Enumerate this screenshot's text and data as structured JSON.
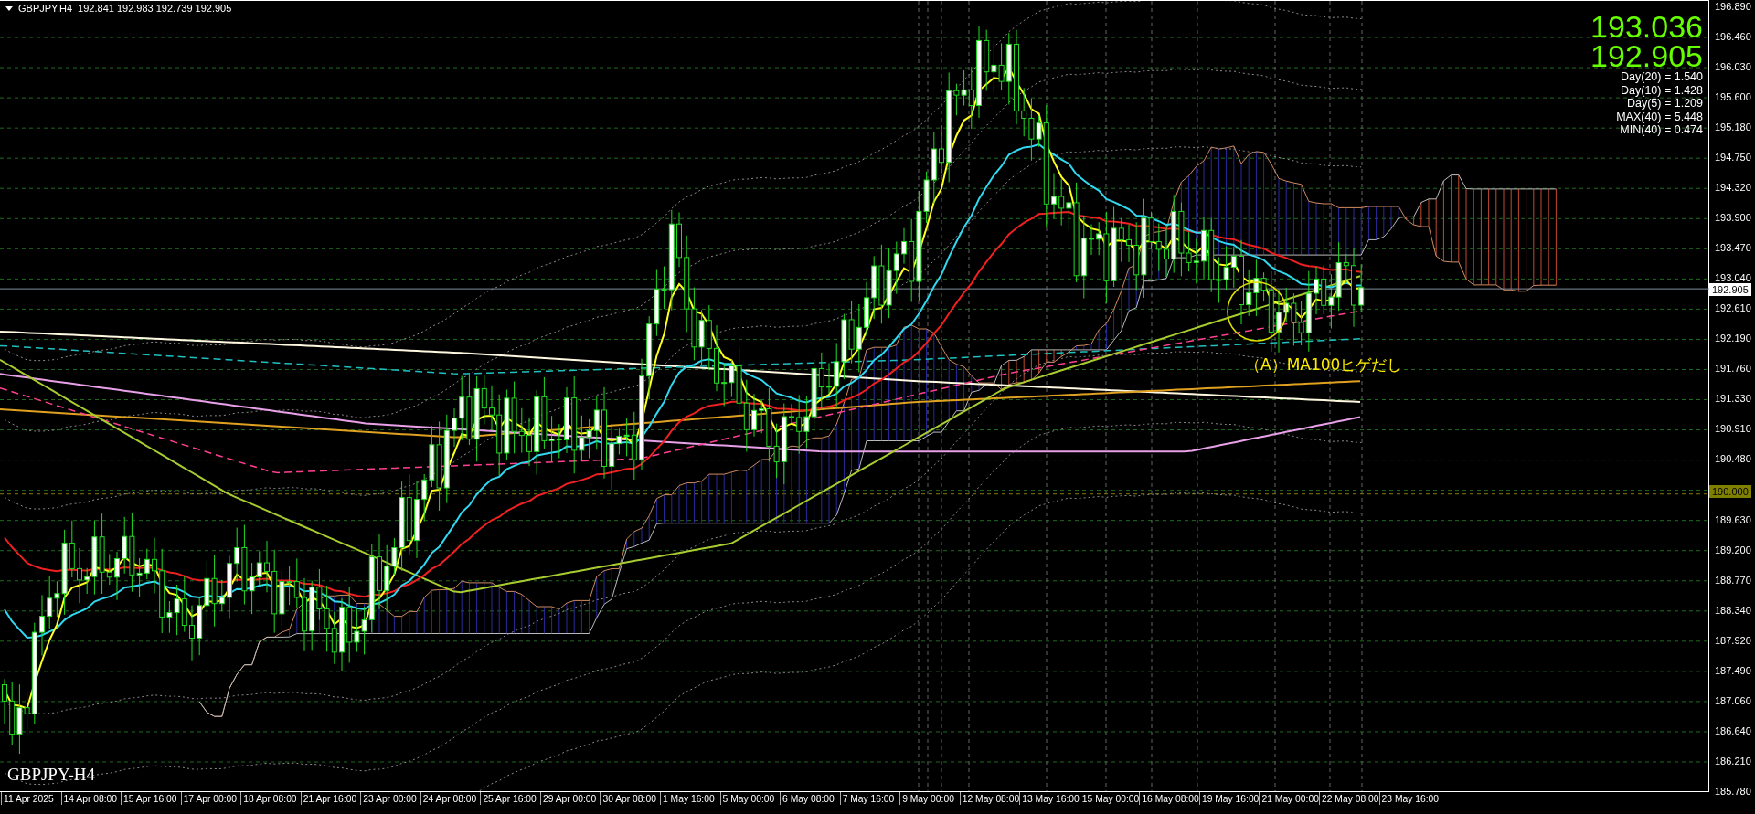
{
  "header": {
    "symbol": "GBPJPY,H4",
    "ohlc": "192.841 192.983 192.739 192.905"
  },
  "quote": {
    "price_1": "193.036",
    "price_2": "192.905"
  },
  "stats": [
    "Day(20) = 1.540",
    "Day(10) = 1.428",
    "Day(5) = 1.209",
    "MAX(40) = 5.448",
    "MIN(40) = 0.474"
  ],
  "price_axis_upper": [
    "196.890",
    "196.460",
    "196.030",
    "195.600",
    "195.180",
    "194.750",
    "194.320",
    "193.900",
    "193.470",
    "193.040",
    "192.610",
    "192.190",
    "191.760",
    "191.330",
    "190.910",
    "190.480"
  ],
  "price_axis_lower": [
    "189.630",
    "189.200",
    "188.770",
    "188.340",
    "187.920",
    "187.490",
    "187.060",
    "186.640",
    "186.210",
    "185.780"
  ],
  "price_tags": [
    {
      "kind": "current",
      "text": "192.905"
    },
    {
      "kind": "level",
      "text": "190.000"
    }
  ],
  "time_axis": [
    "11 Apr 2025",
    "14 Apr 08:00",
    "15 Apr 16:00",
    "17 Apr 00:00",
    "18 Apr 08:00",
    "21 Apr 16:00",
    "23 Apr 00:00",
    "24 Apr 08:00",
    "25 Apr 16:00",
    "29 Apr 00:00",
    "30 Apr 08:00",
    "1 May 16:00",
    "5 May 00:00",
    "6 May 08:00",
    "7 May 16:00",
    "9 May 00:00",
    "12 May 08:00",
    "13 May 16:00",
    "15 May 00:00",
    "16 May 08:00",
    "19 May 16:00",
    "21 May 00:00",
    "22 May 08:00",
    "23 May 16:00"
  ],
  "annotation": "（A）MA100ヒゲだし",
  "chart_label": "GBPJPY-H4"
}
